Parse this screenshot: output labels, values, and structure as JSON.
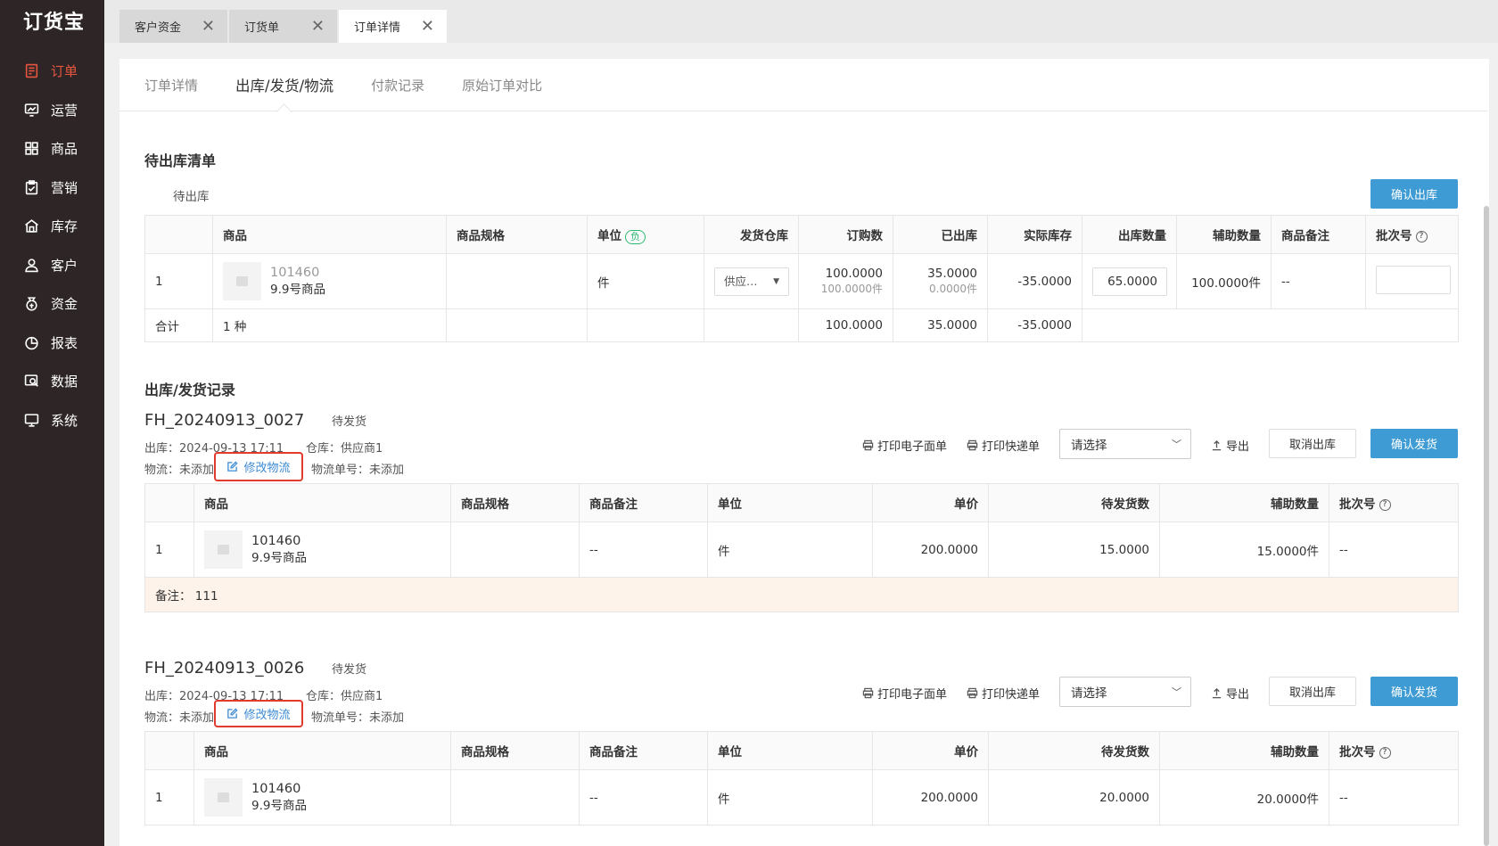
{
  "app": {
    "logo": "订货宝"
  },
  "sidebar": {
    "items": [
      {
        "label": "订单",
        "icon": "order-icon",
        "active": true
      },
      {
        "label": "运营",
        "icon": "operation-icon"
      },
      {
        "label": "商品",
        "icon": "product-icon"
      },
      {
        "label": "营销",
        "icon": "marketing-icon"
      },
      {
        "label": "库存",
        "icon": "inventory-icon"
      },
      {
        "label": "客户",
        "icon": "customer-icon"
      },
      {
        "label": "资金",
        "icon": "funds-icon"
      },
      {
        "label": "报表",
        "icon": "report-icon"
      },
      {
        "label": "数据",
        "icon": "data-icon"
      },
      {
        "label": "系统",
        "icon": "system-icon"
      }
    ]
  },
  "tabs": [
    {
      "label": "客户资金"
    },
    {
      "label": "订货单"
    },
    {
      "label": "订单详情",
      "active": true
    }
  ],
  "subtabs": [
    {
      "label": "订单详情"
    },
    {
      "label": "出库/发货/物流",
      "active": true
    },
    {
      "label": "付款记录"
    },
    {
      "label": "原始订单对比"
    }
  ],
  "pending": {
    "title": "待出库清单",
    "subtitle": "待出库",
    "confirm_btn": "确认出库",
    "badge": "负",
    "headers": [
      "",
      "商品",
      "商品规格",
      "单位",
      "发货仓库",
      "订购数",
      "已出库",
      "实际库存",
      "出库数量",
      "辅助数量",
      "商品备注",
      "批次号"
    ],
    "row": {
      "idx": "1",
      "code": "101460",
      "name": "9.9号商品",
      "spec": "",
      "unit": "件",
      "warehouse": "供应…",
      "ordered": "100.0000",
      "ordered_sub": "100.0000件",
      "shipped": "35.0000",
      "shipped_sub": "0.0000件",
      "stock": "-35.0000",
      "out_qty": "65.0000",
      "aux": "100.0000件",
      "remark": "--",
      "batch": ""
    },
    "total": {
      "label": "合计",
      "kinds": "1 种",
      "ordered": "100.0000",
      "shipped": "35.0000",
      "stock": "-35.0000"
    }
  },
  "records_title": "出库/发货记录",
  "toolbar": {
    "print_e": "打印电子面单",
    "print_express": "打印快递单",
    "select_placeholder": "请选择",
    "export": "导出",
    "cancel": "取消出库",
    "confirm": "确认发货"
  },
  "record_headers": [
    "",
    "商品",
    "商品规格",
    "商品备注",
    "单位",
    "单价",
    "待发货数",
    "辅助数量",
    "批次号"
  ],
  "records": [
    {
      "id": "FH_20240913_0027",
      "status": "待发货",
      "out_time": "出库：2024-09-13 17:11",
      "warehouse": "仓库：供应商1",
      "logistics": "物流：未添加",
      "edit": "修改物流",
      "tracking": "物流单号：未添加",
      "row": {
        "idx": "1",
        "code": "101460",
        "name": "9.9号商品",
        "spec": "",
        "remark": "--",
        "unit": "件",
        "price": "200.0000",
        "qty": "15.0000",
        "aux": "15.0000件",
        "batch": "--"
      },
      "note_label": "备注：",
      "note": "111"
    },
    {
      "id": "FH_20240913_0026",
      "status": "待发货",
      "out_time": "出库：2024-09-13 17:11",
      "warehouse": "仓库：供应商1",
      "logistics": "物流：未添加",
      "edit": "修改物流",
      "tracking": "物流单号：未添加",
      "row": {
        "idx": "1",
        "code": "101460",
        "name": "9.9号商品",
        "spec": "",
        "remark": "--",
        "unit": "件",
        "price": "200.0000",
        "qty": "20.0000",
        "aux": "20.0000件",
        "batch": "--"
      }
    }
  ]
}
